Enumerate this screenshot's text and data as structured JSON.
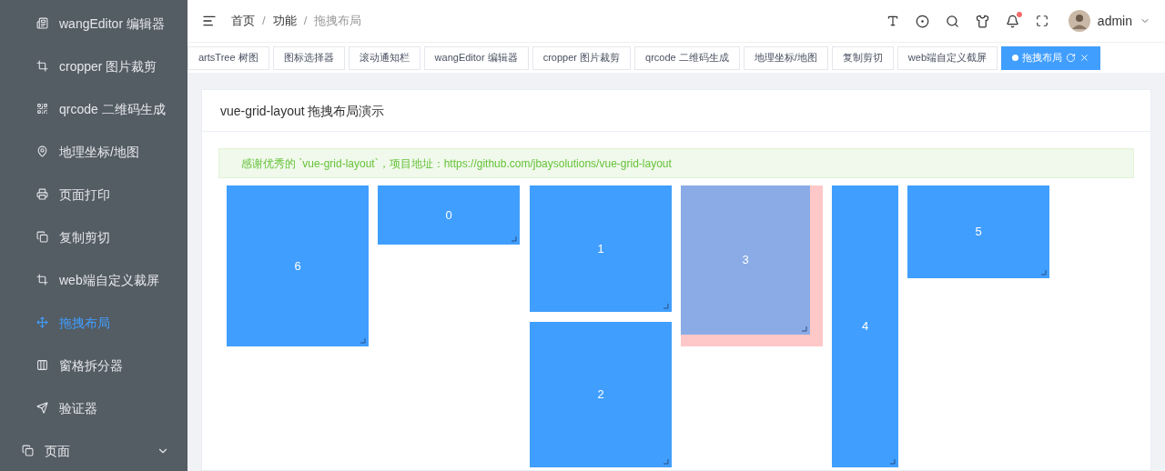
{
  "sidebar": {
    "items": [
      {
        "label": "wangEditor 编辑器",
        "kind": "editor",
        "selected": false
      },
      {
        "label": "cropper 图片裁剪",
        "kind": "crop",
        "selected": false
      },
      {
        "label": "qrcode 二维码生成",
        "kind": "qrcode",
        "selected": false
      },
      {
        "label": "地理坐标/地图",
        "kind": "map",
        "selected": false
      },
      {
        "label": "页面打印",
        "kind": "print",
        "selected": false
      },
      {
        "label": "复制剪切",
        "kind": "copy",
        "selected": false
      },
      {
        "label": "web端自定义裁屏",
        "kind": "crop",
        "selected": false
      },
      {
        "label": "拖拽布局",
        "kind": "move",
        "selected": true
      },
      {
        "label": "窗格拆分器",
        "kind": "split",
        "selected": false
      },
      {
        "label": "验证器",
        "kind": "send",
        "selected": false
      },
      {
        "label": "页面",
        "kind": "group",
        "expanded": false
      }
    ]
  },
  "breadcrumb": [
    "首页",
    "功能",
    "拖拽布局"
  ],
  "breadcrumb_separator": "/",
  "user": {
    "name": "admin"
  },
  "tabs": [
    {
      "label": "artsTree 树图",
      "selected": false
    },
    {
      "label": "图标选择器",
      "selected": false
    },
    {
      "label": "滚动通知栏",
      "selected": false
    },
    {
      "label": "wangEditor 编辑器",
      "selected": false
    },
    {
      "label": "cropper 图片裁剪",
      "selected": false
    },
    {
      "label": "qrcode 二维码生成",
      "selected": false
    },
    {
      "label": "地理坐标/地图",
      "selected": false
    },
    {
      "label": "复制剪切",
      "selected": false
    },
    {
      "label": "web端自定义截屏",
      "selected": false
    },
    {
      "label": "拖拽布局",
      "selected": true
    }
  ],
  "card": {
    "title": "vue-grid-layout 拖拽布局演示",
    "alert": "感谢优秀的 `vue-grid-layout`，项目地址：https://github.com/jbaysolutions/vue-grid-layout"
  },
  "grid_items": [
    {
      "label": "6",
      "dragging": false
    },
    {
      "label": "0",
      "dragging": false
    },
    {
      "label": "1",
      "dragging": false
    },
    {
      "label": "2",
      "dragging": false
    },
    {
      "label": "3",
      "dragging": true
    },
    {
      "label": "4",
      "dragging": false
    },
    {
      "label": "5",
      "dragging": false
    }
  ]
}
